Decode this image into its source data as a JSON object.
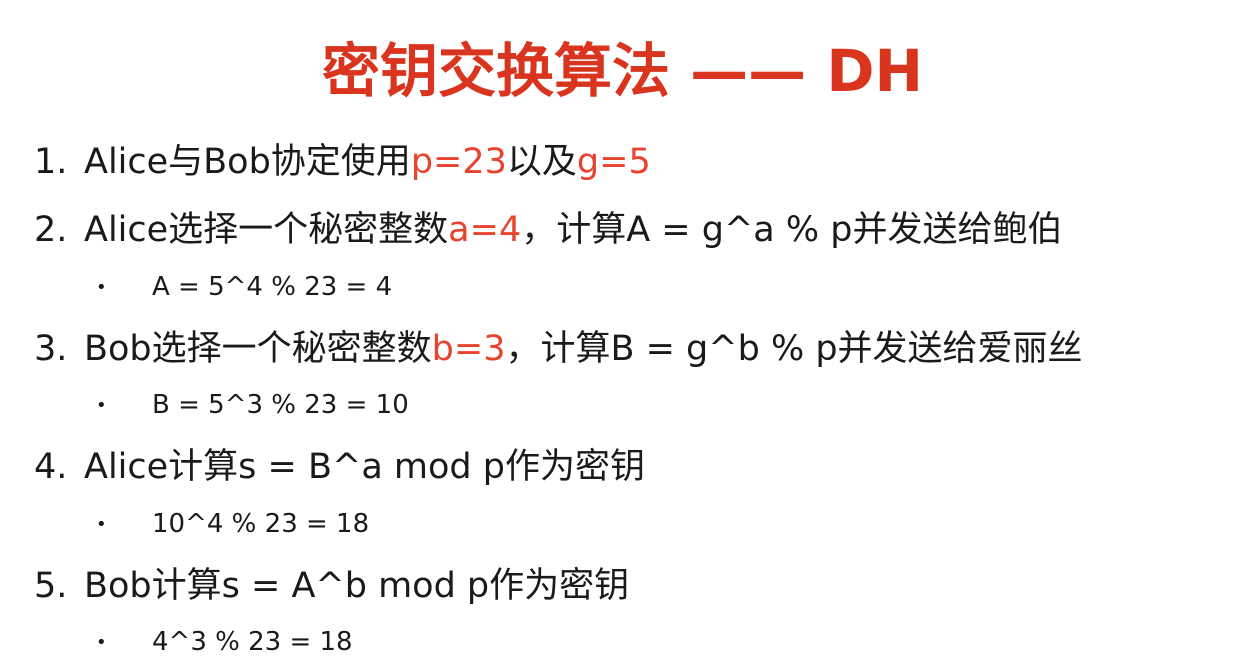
{
  "title": "密钥交换算法 —— DH",
  "steps": [
    {
      "num": "1.",
      "parts": [
        "Alice与Bob协定使用",
        "p=23",
        "以及",
        "g=5",
        ""
      ],
      "sub": ""
    },
    {
      "num": "2.",
      "parts": [
        "Alice选择一个秘密整数",
        "a=4",
        "，计算A = g^a % p并发送给鲍伯",
        "",
        ""
      ],
      "sub": "A = 5^4 % 23 = 4"
    },
    {
      "num": "3.",
      "parts": [
        "Bob选择一个秘密整数",
        "b=3",
        "，计算B = g^b % p并发送给爱丽丝",
        "",
        ""
      ],
      "sub": "B = 5^3 % 23 = 10"
    },
    {
      "num": "4.",
      "parts": [
        "Alice计算s = B^a mod p作为密钥",
        "",
        "",
        "",
        ""
      ],
      "sub": "10^4 % 23 = 18"
    },
    {
      "num": "5.",
      "parts": [
        "Bob计算s = A^b mod p作为密钥",
        "",
        "",
        "",
        ""
      ],
      "sub": "4^3 % 23 = 18"
    }
  ],
  "bullet": "•",
  "colors": {
    "title": "#d9341e",
    "highlight": "#e8432e",
    "text": "#1a1a1a",
    "background": "#ffffff"
  }
}
